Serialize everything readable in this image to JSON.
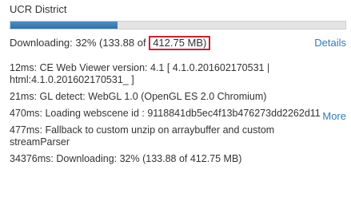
{
  "panel": {
    "title": "UCR District",
    "progress_percent": 32,
    "status_prefix": "Downloading: 32% (133.88 of ",
    "status_highlight": "412.75 MB)",
    "details_label": "Details",
    "more_label": "More"
  },
  "log": {
    "entries": [
      "12ms: CE Web Viewer version: 4.1 [ 4.1.0.201602170531 | html:4.1.0.201602170531_ ]",
      "21ms: GL detect: WebGL 1.0 (OpenGL ES 2.0 Chromium)",
      "470ms: Loading webscene id : 9118841db5ec4f13b476273dd2262d11",
      "477ms: Fallback to custom unzip on arraybuffer and custom streamParser",
      "34376ms: Downloading: 32% (133.88 of 412.75 MB)"
    ]
  },
  "colors": {
    "progress_fill": "#2f6fa8",
    "link": "#2f7bbf",
    "highlight_border": "#d02030"
  }
}
